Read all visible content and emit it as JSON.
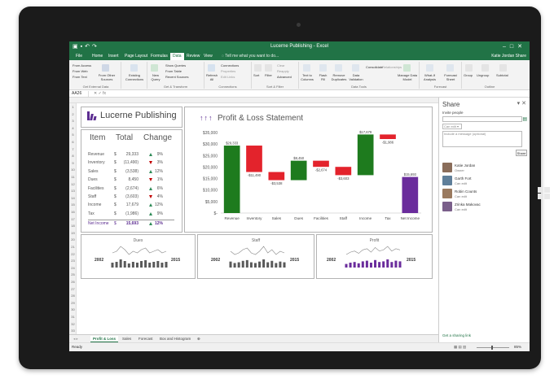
{
  "window": {
    "title": "Lucerne Publishing - Excel",
    "account": "Katie Jordan",
    "share_label": "Share"
  },
  "tabs": [
    "File",
    "Home",
    "Insert",
    "Page Layout",
    "Formulas",
    "Data",
    "Review",
    "View"
  ],
  "active_tab": "Data",
  "tell_me": "Tell me what you want to do...",
  "ribbon": {
    "buttons": [
      {
        "label": "From Access"
      },
      {
        "label": "From Web"
      },
      {
        "label": "From Text"
      },
      {
        "label": "From Other Sources"
      },
      {
        "label": "Existing Connections"
      },
      {
        "label": "New Query"
      },
      {
        "label": "Show Queries"
      },
      {
        "label": "From Table"
      },
      {
        "label": "Recent Sources"
      },
      {
        "label": "Refresh All"
      },
      {
        "label": "Connections"
      },
      {
        "label": "Properties"
      },
      {
        "label": "Edit Links"
      },
      {
        "label": "Sort"
      },
      {
        "label": "Filter"
      },
      {
        "label": "Clear"
      },
      {
        "label": "Reapply"
      },
      {
        "label": "Advanced"
      },
      {
        "label": "Text to Columns"
      },
      {
        "label": "Flash Fill"
      },
      {
        "label": "Remove Duplicates"
      },
      {
        "label": "Data Validation"
      },
      {
        "label": "Consolidate"
      },
      {
        "label": "Relationships"
      },
      {
        "label": "Manage Data Model"
      },
      {
        "label": "What-If Analysis"
      },
      {
        "label": "Forecast Sheet"
      },
      {
        "label": "Group"
      },
      {
        "label": "Ungroup"
      },
      {
        "label": "Subtotal"
      }
    ],
    "groups": [
      "Get External Data",
      "Get & Transform",
      "Connections",
      "Sort & Filter",
      "Data Tools",
      "Forecast",
      "Outline"
    ]
  },
  "name_box": "AA26",
  "row_numbers": [
    "1",
    "2",
    "3",
    "4",
    "5",
    "6",
    "7",
    "8",
    "9",
    "10",
    "11",
    "12",
    "13",
    "14",
    "15",
    "16",
    "17",
    "18",
    "19",
    "20",
    "21",
    "22",
    "23",
    "24",
    "25",
    "26",
    "27",
    "28",
    "29",
    "30",
    "31",
    "32",
    "33"
  ],
  "brand": {
    "name": "Lucerne Publishing"
  },
  "summary_table": {
    "headers": [
      "Item",
      "Total",
      "Change"
    ],
    "rows": [
      {
        "item": "Revenue",
        "cur": "$",
        "total": "29,333",
        "dir": "up",
        "change": "9%"
      },
      {
        "item": "Inventory",
        "cur": "$",
        "total": "(11,490)",
        "dir": "down",
        "change": "3%"
      },
      {
        "item": "Sales",
        "cur": "$",
        "total": "(3,538)",
        "dir": "up",
        "change": "12%"
      },
      {
        "item": "Dues",
        "cur": "$",
        "total": "8,450",
        "dir": "down",
        "change": "1%"
      },
      {
        "item": "Facilities",
        "cur": "$",
        "total": "(2,674)",
        "dir": "up",
        "change": "6%"
      },
      {
        "item": "Staff",
        "cur": "$",
        "total": "(3,603)",
        "dir": "down",
        "change": "4%"
      },
      {
        "item": "Income",
        "cur": "$",
        "total": "17,679",
        "dir": "up",
        "change": "12%"
      },
      {
        "item": "Tax",
        "cur": "$",
        "total": "(1,986)",
        "dir": "up",
        "change": "9%"
      }
    ],
    "net": {
      "item": "Net Income",
      "cur": "$",
      "total": "15,693",
      "dir": "up",
      "change": "12%"
    }
  },
  "pl_chart": {
    "title": "Profit & Loss Statement"
  },
  "chart_data": {
    "type": "bar",
    "subtype": "waterfall",
    "title": "Profit & Loss Statement",
    "categories": [
      "Revenue",
      "Inventory",
      "Sales",
      "Dues",
      "Facilities",
      "Staff",
      "Income",
      "Tax",
      "Net Income"
    ],
    "values": [
      29333,
      -11490,
      -3538,
      8450,
      -2674,
      -3603,
      17679,
      -1986,
      15693
    ],
    "data_labels": [
      "$29,333",
      "-$11,490",
      "-$3,538",
      "$8,450",
      "-$2,674",
      "-$3,603",
      "$17,679",
      "-$1,986",
      "$15,693"
    ],
    "ytick_labels": [
      "$35,000",
      "$30,000",
      "$25,000",
      "$20,000",
      "$15,000",
      "$10,000",
      "$5,000",
      "$-"
    ],
    "ylim": [
      0,
      35000
    ],
    "colors": {
      "increase": "#1e7b1e",
      "decrease": "#e3232c",
      "total": "#6a2c9c"
    }
  },
  "sparklines": [
    {
      "title": "Dues",
      "start": "2002",
      "end": "2015",
      "values": [
        4,
        5,
        8,
        6,
        3,
        5,
        4,
        6,
        7,
        4,
        5,
        6,
        4,
        5
      ],
      "color": "#595959"
    },
    {
      "title": "Staff",
      "start": "2002",
      "end": "2015",
      "values": [
        6,
        4,
        5,
        7,
        8,
        5,
        4,
        6,
        9,
        5,
        7,
        4,
        6,
        5
      ],
      "color": "#595959"
    },
    {
      "title": "Profit",
      "start": "2002",
      "end": "2015",
      "values": [
        3,
        5,
        6,
        4,
        7,
        8,
        5,
        9,
        6,
        7,
        10,
        6,
        8,
        7
      ],
      "color": "#6a2c9c"
    }
  ],
  "sheet_tabs": [
    "Profit & Loss",
    "Sales",
    "Forecast",
    "Box and Histogram"
  ],
  "active_sheet": "Profit & Loss",
  "status": {
    "left": "Ready",
    "zoom": "85%"
  },
  "share_pane": {
    "title": "Share",
    "invite_label": "Invite people",
    "permission": "Can edit",
    "message_placeholder": "Include a message (optional)",
    "share_button": "Share",
    "people": [
      {
        "name": "Katie Jordan",
        "role": "Owner",
        "color": "#8a6d5a"
      },
      {
        "name": "Garth Fort",
        "role": "Can edit",
        "color": "#5f7f9a"
      },
      {
        "name": "Robin Counts",
        "role": "Can edit",
        "color": "#9a7a5f"
      },
      {
        "name": "Zrinka Makovac",
        "role": "Can edit",
        "color": "#7a5f8a"
      }
    ],
    "link_label": "Get a sharing link"
  }
}
